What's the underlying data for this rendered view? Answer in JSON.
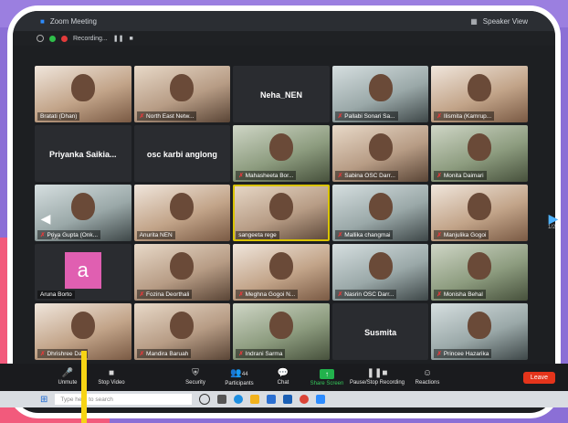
{
  "window": {
    "title": "Zoom Meeting",
    "speaker_view": "Speaker View",
    "recording": "Recording..."
  },
  "participants": [
    {
      "name": "Bratati (Dhan)",
      "type": "photo",
      "muted": false,
      "tone": "c3"
    },
    {
      "name": "North East Netw...",
      "type": "photo",
      "muted": true,
      "tone": "c1"
    },
    {
      "name": "Neha_NEN",
      "type": "name",
      "muted": false
    },
    {
      "name": "Pallabi Sonari Sa...",
      "type": "photo",
      "muted": true,
      "tone": "c2"
    },
    {
      "name": "Ilismita (Kamrup...",
      "type": "photo",
      "muted": true,
      "tone": "c3"
    },
    {
      "name": "Priyanka Saikia...",
      "type": "name",
      "muted": false
    },
    {
      "name": "osc karbi anglong",
      "type": "name",
      "muted": false
    },
    {
      "name": "Mahasheeta Bor...",
      "type": "photo",
      "muted": true,
      "tone": "c4"
    },
    {
      "name": "Sabina OSC Darr...",
      "type": "photo",
      "muted": true,
      "tone": "c1"
    },
    {
      "name": "Monita Daimari",
      "type": "photo",
      "muted": true,
      "tone": "c4"
    },
    {
      "name": "Priya Gupta (Onk...",
      "type": "photo",
      "muted": true,
      "tone": "c2"
    },
    {
      "name": "Anurita NEN",
      "type": "photo",
      "muted": false,
      "tone": "c3"
    },
    {
      "name": "sangeeta rege",
      "type": "photo",
      "muted": false,
      "tone": "c1",
      "active": true
    },
    {
      "name": "Mallika changmai",
      "type": "photo",
      "muted": true,
      "tone": "c2"
    },
    {
      "name": "Manjulika Gogoi",
      "type": "photo",
      "muted": true,
      "tone": "c3"
    },
    {
      "name": "Aruna Borto",
      "type": "avatar",
      "muted": false,
      "letter": "a"
    },
    {
      "name": "Fozina Deorthali",
      "type": "photo",
      "muted": true,
      "tone": "c1"
    },
    {
      "name": "Meghna Gogoi N...",
      "type": "photo",
      "muted": true,
      "tone": "c3"
    },
    {
      "name": "Nasrin OSC Darr...",
      "type": "photo",
      "muted": true,
      "tone": "c2"
    },
    {
      "name": "Monisha Behal",
      "type": "photo",
      "muted": true,
      "tone": "c4"
    },
    {
      "name": "Dhrishree Das",
      "type": "photo",
      "muted": true,
      "tone": "c3"
    },
    {
      "name": "Mandira Baruah",
      "type": "photo",
      "muted": true,
      "tone": "c1"
    },
    {
      "name": "Indrani Sarma",
      "type": "photo",
      "muted": true,
      "tone": "c4"
    },
    {
      "name": "Susmita",
      "type": "name",
      "muted": false
    },
    {
      "name": "Princee Hazarika",
      "type": "photo",
      "muted": true,
      "tone": "c2"
    }
  ],
  "page_indicator_left": "1/2",
  "page_indicator_right": "1/2",
  "toolbar": {
    "unmute": "Unmute",
    "stop_video": "Stop Video",
    "security": "Security",
    "participants": "Participants",
    "participants_count": "44",
    "chat": "Chat",
    "share_screen": "Share Screen",
    "pause_recording": "Pause/Stop Recording",
    "reactions": "Reactions",
    "leave": "Leave"
  },
  "taskbar": {
    "search_placeholder": "Type here to search"
  },
  "colors": {
    "accent_yellow": "#f7d414",
    "leave_red": "#e5341b",
    "share_green": "#22b24c"
  }
}
